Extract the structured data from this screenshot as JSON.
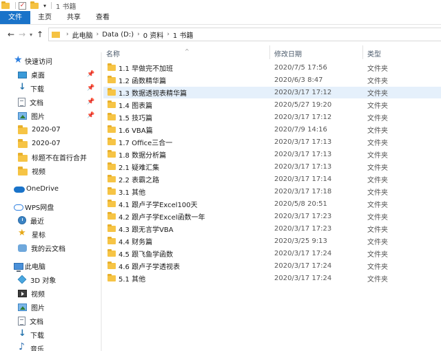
{
  "window": {
    "title": "1 书籍"
  },
  "ribbon": {
    "tabs": [
      "文件",
      "主页",
      "共享",
      "查看"
    ]
  },
  "address": {
    "crumbs": [
      "此电脑",
      "Data (D:)",
      "0 资料",
      "1 书籍"
    ]
  },
  "columns": {
    "name": "名称",
    "date": "修改日期",
    "type": "类型"
  },
  "sidebar": {
    "quick_access": "快速访问",
    "items": [
      {
        "label": "桌面",
        "icon": "desktop-icon",
        "pinned": true
      },
      {
        "label": "下载",
        "icon": "download-icon",
        "pinned": true
      },
      {
        "label": "文档",
        "icon": "document-icon",
        "pinned": true
      },
      {
        "label": "图片",
        "icon": "picture-icon",
        "pinned": true
      },
      {
        "label": "2020-07",
        "icon": "folder-icon",
        "pinned": false
      },
      {
        "label": "2020-07",
        "icon": "folder-icon",
        "pinned": false
      },
      {
        "label": "标题不在首行合并",
        "icon": "folder-icon",
        "pinned": false
      },
      {
        "label": "视频",
        "icon": "folder-icon",
        "pinned": false
      }
    ],
    "onedrive": "OneDrive",
    "wps": "WPS网盘",
    "wps_items": [
      {
        "label": "最近",
        "icon": "clock-icon"
      },
      {
        "label": "星标",
        "icon": "star-icon"
      },
      {
        "label": "我的云文档",
        "icon": "cloud-doc-icon"
      }
    ],
    "this_pc": "此电脑",
    "pc_items": [
      {
        "label": "3D 对象",
        "icon": "3d-objects-icon"
      },
      {
        "label": "视频",
        "icon": "video-icon"
      },
      {
        "label": "图片",
        "icon": "picture-icon"
      },
      {
        "label": "文档",
        "icon": "document-icon"
      },
      {
        "label": "下载",
        "icon": "download-icon"
      },
      {
        "label": "音乐",
        "icon": "music-icon"
      }
    ]
  },
  "files": [
    {
      "name": "1.1 早做完不加班",
      "date": "2020/7/5 17:56",
      "type": "文件夹"
    },
    {
      "name": "1.2 函数精华篇",
      "date": "2020/6/3 8:47",
      "type": "文件夹"
    },
    {
      "name": "1.3 数据透视表精华篇",
      "date": "2020/3/17 17:12",
      "type": "文件夹",
      "selected": true
    },
    {
      "name": "1.4 图表篇",
      "date": "2020/5/27 19:20",
      "type": "文件夹"
    },
    {
      "name": "1.5 技巧篇",
      "date": "2020/3/17 17:12",
      "type": "文件夹"
    },
    {
      "name": "1.6 VBA篇",
      "date": "2020/7/9 14:16",
      "type": "文件夹"
    },
    {
      "name": "1.7 Office三合一",
      "date": "2020/3/17 17:13",
      "type": "文件夹"
    },
    {
      "name": "1.8 数据分析篇",
      "date": "2020/3/17 17:13",
      "type": "文件夹"
    },
    {
      "name": "2.1 疑难汇集",
      "date": "2020/3/17 17:13",
      "type": "文件夹"
    },
    {
      "name": "2.2 表霸之路",
      "date": "2020/3/17 17:14",
      "type": "文件夹"
    },
    {
      "name": "3.1 其他",
      "date": "2020/3/17 17:18",
      "type": "文件夹"
    },
    {
      "name": "4.1 跟卢子学Excel100天",
      "date": "2020/5/8 20:51",
      "type": "文件夹"
    },
    {
      "name": "4.2 跟卢子学Excel函数一年",
      "date": "2020/3/17 17:23",
      "type": "文件夹"
    },
    {
      "name": "4.3 跟无言学VBA",
      "date": "2020/3/17 17:23",
      "type": "文件夹"
    },
    {
      "name": "4.4 财务篇",
      "date": "2020/3/25 9:13",
      "type": "文件夹"
    },
    {
      "name": "4.5 跟飞鱼学函数",
      "date": "2020/3/17 17:24",
      "type": "文件夹"
    },
    {
      "name": "4.6 跟卢子学透视表",
      "date": "2020/3/17 17:24",
      "type": "文件夹"
    },
    {
      "name": "5.1 其他",
      "date": "2020/3/17 17:24",
      "type": "文件夹"
    }
  ],
  "colors": {
    "accent": "#1a73c9",
    "selection": "#e5f0fb",
    "folder": "#f6c445"
  }
}
